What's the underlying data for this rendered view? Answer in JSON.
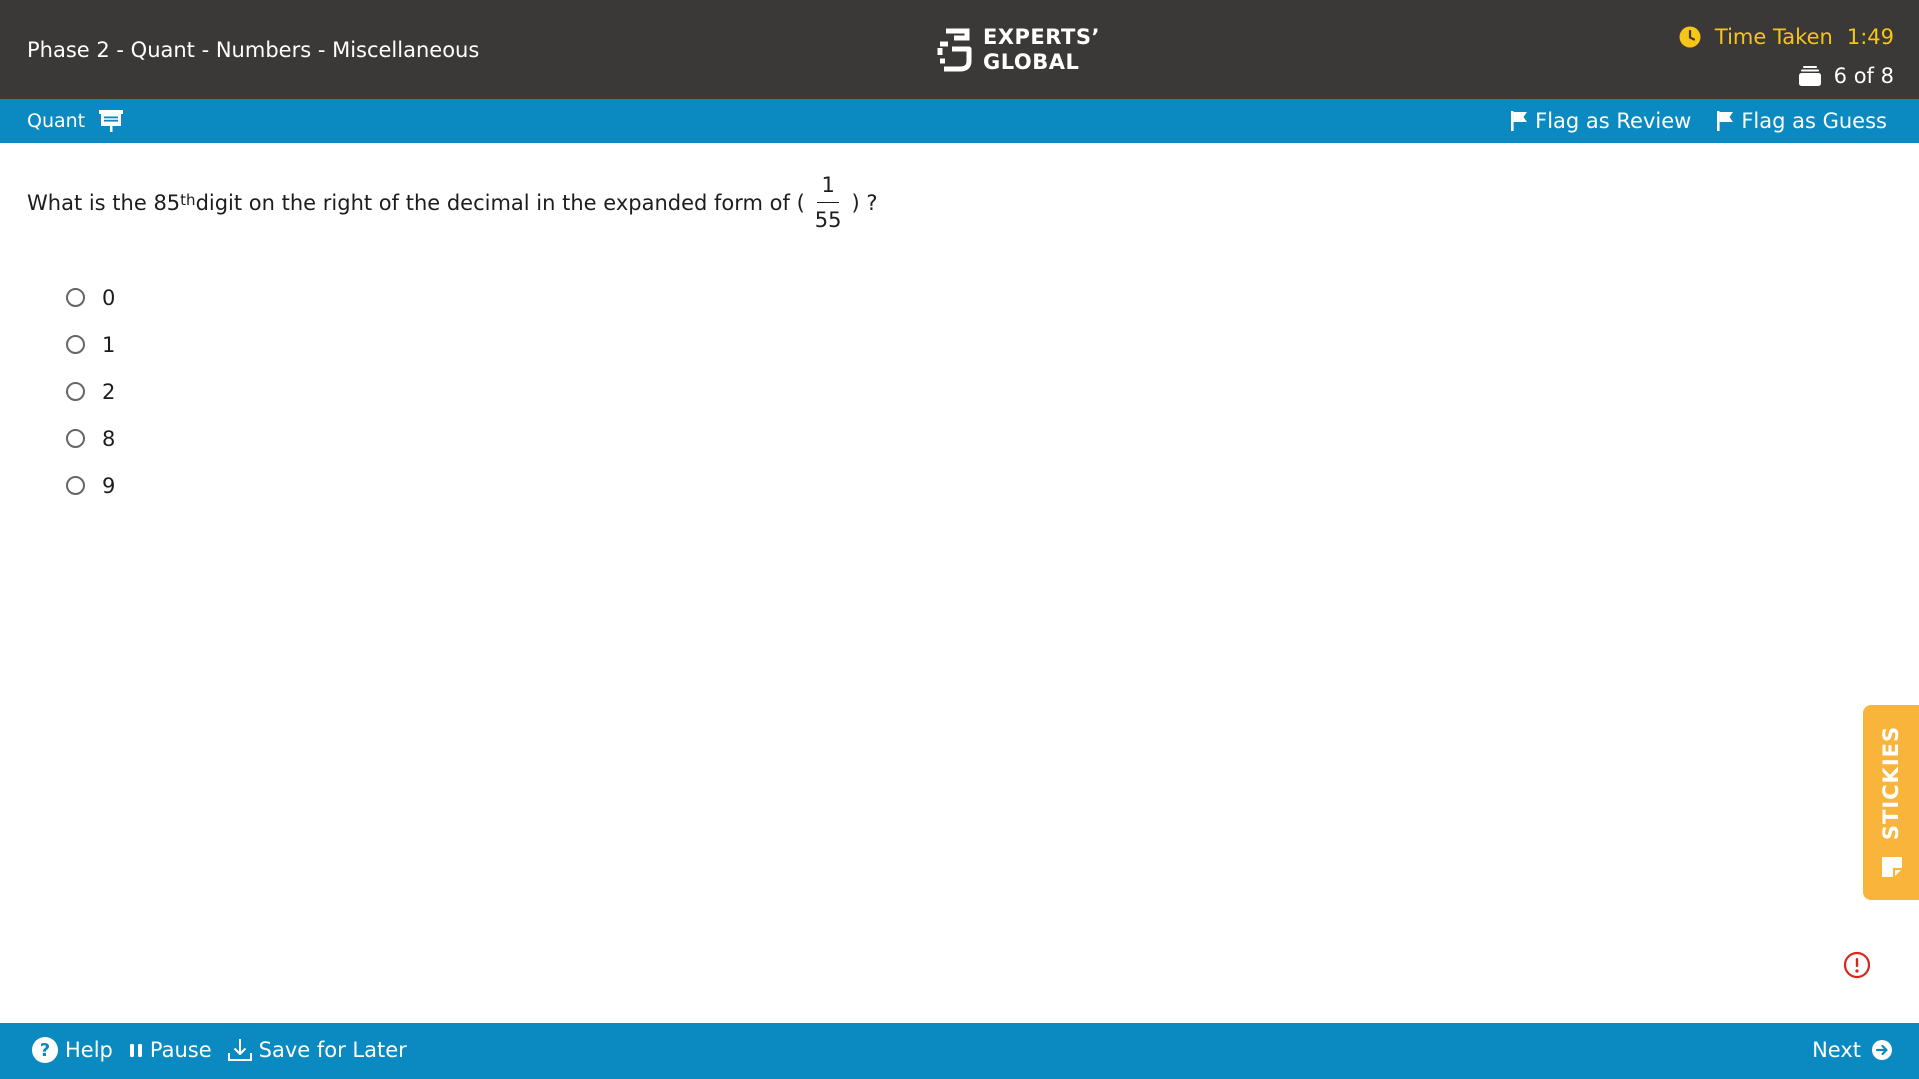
{
  "header": {
    "title": "Phase 2 - Quant - Numbers - Miscellaneous",
    "logo": {
      "line1": "EXPERTS’",
      "line2": "GLOBAL"
    },
    "timer": {
      "label": "Time Taken",
      "value": "1:49",
      "color": "#f5c518",
      "icon": "clock-icon"
    },
    "progress": {
      "text": "6 of 8",
      "icon": "question-stack-icon"
    }
  },
  "section_bar": {
    "section": "Quant",
    "section_icon": "calculator-icon",
    "flag_review": "Flag as Review",
    "flag_guess": "Flag as Guess",
    "flag_icon": "flag-icon"
  },
  "question": {
    "prefix": "What is the 85",
    "superscript": "th",
    "middle": " digit on the right of the decimal in the expanded form of (",
    "numerator": "1",
    "denominator": "55",
    "suffix": ") ?"
  },
  "options": [
    "0",
    "1",
    "2",
    "8",
    "9"
  ],
  "stickies": {
    "label": "STICKIES",
    "color": "#f9b43c",
    "icon": "sticky-note-icon"
  },
  "footer": {
    "help": "Help",
    "pause": "Pause",
    "save_later": "Save for Later",
    "next": "Next"
  },
  "colors": {
    "header_bg": "#3b3838",
    "bar_bg": "#0b8ac1",
    "report_icon": "#d9261c"
  }
}
